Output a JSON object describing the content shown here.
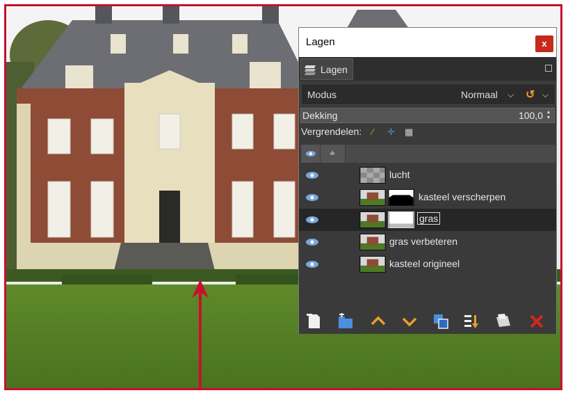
{
  "window": {
    "title": "Lagen",
    "close_glyph": "x"
  },
  "tab": {
    "label": "Lagen"
  },
  "mode": {
    "label": "Modus",
    "value": "Normaal"
  },
  "opacity": {
    "label": "Dekking",
    "value": "100,0"
  },
  "lock": {
    "label": "Vergrendelen:"
  },
  "layers": [
    {
      "name": "lucht",
      "visible": true,
      "has_mask": false,
      "selected": false
    },
    {
      "name": "kasteel verscherpen",
      "visible": true,
      "has_mask": true,
      "selected": false
    },
    {
      "name": "gras",
      "visible": true,
      "has_mask": true,
      "selected": true
    },
    {
      "name": "gras verbeteren",
      "visible": true,
      "has_mask": false,
      "selected": false
    },
    {
      "name": "kasteel origineel",
      "visible": true,
      "has_mask": false,
      "selected": false
    }
  ],
  "toolbar": [
    "new-layer-icon",
    "new-layer-group-icon",
    "raise-layer-icon",
    "lower-layer-icon",
    "duplicate-layer-icon",
    "merge-down-icon",
    "add-mask-icon",
    "delete-layer-icon"
  ],
  "colors": {
    "frame": "#c8102e",
    "panel_bg": "#3a3a3a",
    "accent_orange": "#e8a028",
    "delete_red": "#d9261c"
  }
}
